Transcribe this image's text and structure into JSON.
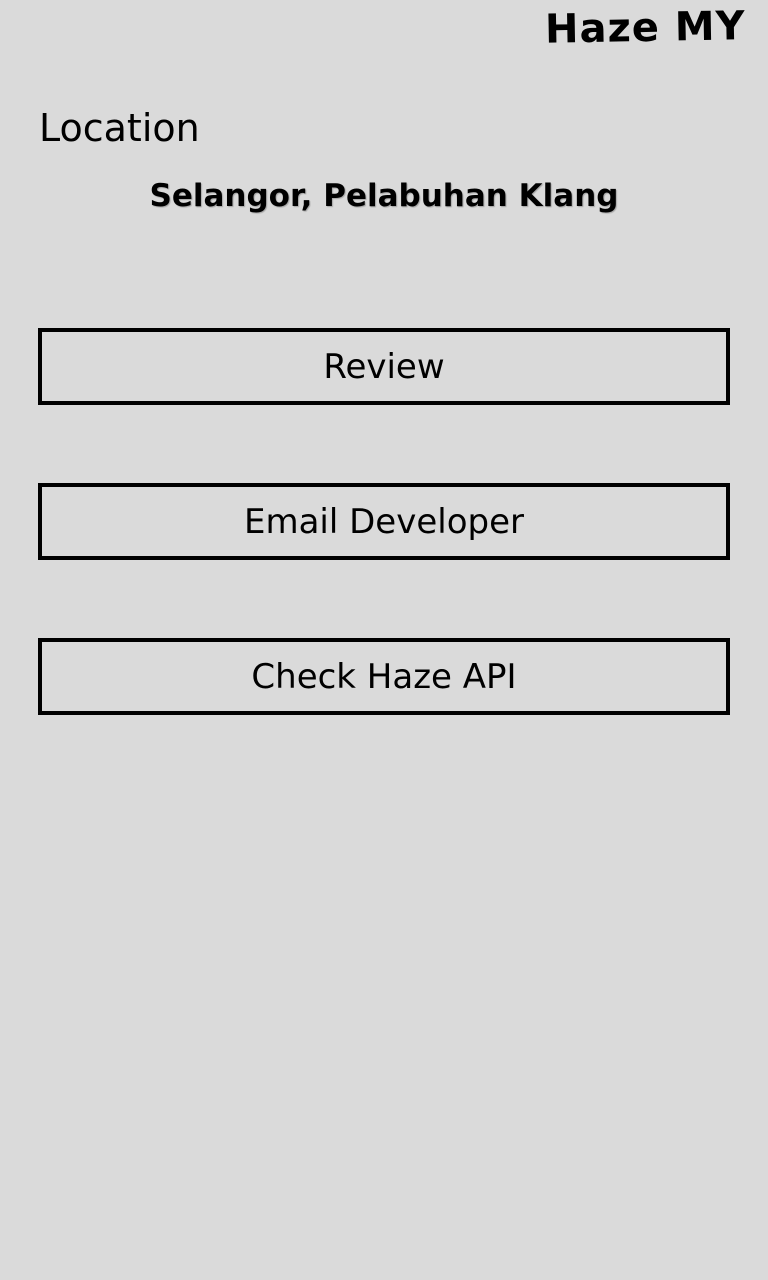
{
  "app": {
    "title": "Haze MY"
  },
  "location": {
    "label": "Location",
    "value": "Selangor, Pelabuhan Klang"
  },
  "actions": {
    "review_label": "Review",
    "email_label": "Email Developer",
    "api_label": "Check Haze API"
  },
  "colors": {
    "background": "#dadada",
    "text": "#000000",
    "button_border": "#000000"
  }
}
